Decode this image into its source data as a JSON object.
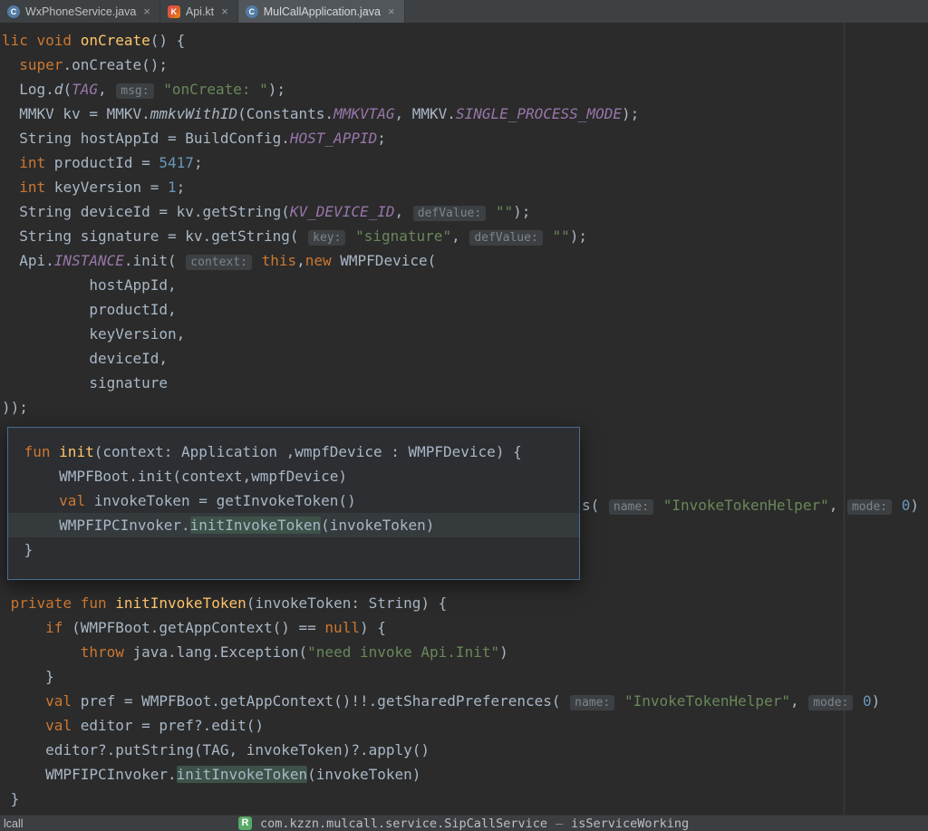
{
  "tab_bar": {
    "tabs": [
      {
        "id": "wxphoneservice-java",
        "label": "WxPhoneService.java",
        "icon": "java-class",
        "icon_letter": "C",
        "close": "×",
        "active": false
      },
      {
        "id": "api-kt",
        "label": "Api.kt",
        "icon": "kotlin",
        "icon_letter": "K",
        "close": "×",
        "active": false
      },
      {
        "id": "mulcallapplication-java",
        "label": "MulCallApplication.java",
        "icon": "java-class",
        "icon_letter": "C",
        "close": "×",
        "active": true
      }
    ]
  },
  "editor": {
    "top_lines": [
      {
        "tokens": [
          {
            "t": "lic ",
            "c": "kw"
          },
          {
            "t": "void ",
            "c": "kw"
          },
          {
            "t": "onCreate",
            "c": "method"
          },
          {
            "t": "() {",
            "c": "plain"
          }
        ]
      },
      {
        "tokens": [
          {
            "t": "  ",
            "c": "plain"
          },
          {
            "t": "super",
            "c": "kw"
          },
          {
            "t": ".onCreate();",
            "c": "plain"
          }
        ]
      },
      {
        "tokens": [
          {
            "t": "  Log.",
            "c": "plain"
          },
          {
            "t": "d",
            "c": "smethod"
          },
          {
            "t": "(",
            "c": "plain"
          },
          {
            "t": "TAG",
            "c": "const"
          },
          {
            "t": ", ",
            "c": "plain"
          },
          {
            "t": "msg:",
            "c": "hint"
          },
          {
            "t": " ",
            "c": "plain"
          },
          {
            "t": "\"onCreate: \"",
            "c": "str"
          },
          {
            "t": ");",
            "c": "plain"
          }
        ]
      },
      {
        "tokens": [
          {
            "t": "  MMKV kv = MMKV.",
            "c": "plain"
          },
          {
            "t": "mmkvWithID",
            "c": "smethod"
          },
          {
            "t": "(Constants.",
            "c": "plain"
          },
          {
            "t": "MMKVTAG",
            "c": "const"
          },
          {
            "t": ", MMKV.",
            "c": "plain"
          },
          {
            "t": "SINGLE_PROCESS_MODE",
            "c": "const"
          },
          {
            "t": ");",
            "c": "plain"
          }
        ]
      },
      {
        "tokens": [
          {
            "t": "  String hostAppId = BuildConfig.",
            "c": "plain"
          },
          {
            "t": "HOST_APPID",
            "c": "const"
          },
          {
            "t": ";",
            "c": "plain"
          }
        ]
      },
      {
        "tokens": [
          {
            "t": "  ",
            "c": "plain"
          },
          {
            "t": "int",
            "c": "kw"
          },
          {
            "t": " productId = ",
            "c": "plain"
          },
          {
            "t": "5417",
            "c": "num"
          },
          {
            "t": ";",
            "c": "plain"
          }
        ]
      },
      {
        "tokens": [
          {
            "t": "  ",
            "c": "plain"
          },
          {
            "t": "int",
            "c": "kw"
          },
          {
            "t": " keyVersion = ",
            "c": "plain"
          },
          {
            "t": "1",
            "c": "num"
          },
          {
            "t": ";",
            "c": "plain"
          }
        ]
      },
      {
        "tokens": [
          {
            "t": "  String deviceId = kv.getString(",
            "c": "plain"
          },
          {
            "t": "KV_DEVICE_ID",
            "c": "const"
          },
          {
            "t": ", ",
            "c": "plain"
          },
          {
            "t": "defValue:",
            "c": "hint"
          },
          {
            "t": " ",
            "c": "plain"
          },
          {
            "t": "\"\"",
            "c": "str"
          },
          {
            "t": ");",
            "c": "plain"
          }
        ]
      },
      {
        "tokens": [
          {
            "t": "  String signature = kv.getString( ",
            "c": "plain"
          },
          {
            "t": "key:",
            "c": "hint"
          },
          {
            "t": " ",
            "c": "plain"
          },
          {
            "t": "\"signature\"",
            "c": "str"
          },
          {
            "t": ", ",
            "c": "plain"
          },
          {
            "t": "defValue:",
            "c": "hint"
          },
          {
            "t": " ",
            "c": "plain"
          },
          {
            "t": "\"\"",
            "c": "str"
          },
          {
            "t": ");",
            "c": "plain"
          }
        ]
      },
      {
        "tokens": [
          {
            "t": "  Api.",
            "c": "plain"
          },
          {
            "t": "INSTANCE",
            "c": "const"
          },
          {
            "t": ".init( ",
            "c": "plain"
          },
          {
            "t": "context:",
            "c": "hint"
          },
          {
            "t": " ",
            "c": "plain"
          },
          {
            "t": "this",
            "c": "kw"
          },
          {
            "t": ",",
            "c": "plain"
          },
          {
            "t": "new",
            "c": "kw"
          },
          {
            "t": " WMPFDevice(",
            "c": "plain"
          }
        ]
      },
      {
        "tokens": [
          {
            "t": "          hostAppId,",
            "c": "plain"
          }
        ]
      },
      {
        "tokens": [
          {
            "t": "          productId,",
            "c": "plain"
          }
        ]
      },
      {
        "tokens": [
          {
            "t": "          keyVersion,",
            "c": "plain"
          }
        ]
      },
      {
        "tokens": [
          {
            "t": "          deviceId,",
            "c": "plain"
          }
        ]
      },
      {
        "tokens": [
          {
            "t": "          signature",
            "c": "plain"
          }
        ]
      },
      {
        "tokens": [
          {
            "t": "));",
            "c": "plain"
          }
        ]
      }
    ],
    "fragment_lines": [
      {
        "tokens": [
          {
            "t": "s( ",
            "c": "plain"
          },
          {
            "t": "name:",
            "c": "hint"
          },
          {
            "t": " ",
            "c": "plain"
          },
          {
            "t": "\"InvokeTokenHelper\"",
            "c": "str"
          },
          {
            "t": ", ",
            "c": "plain"
          },
          {
            "t": "mode:",
            "c": "hint"
          },
          {
            "t": " ",
            "c": "plain"
          },
          {
            "t": "0",
            "c": "num"
          },
          {
            "t": ")",
            "c": "plain"
          }
        ]
      }
    ],
    "lower_lines": [
      {
        "tokens": [
          {
            "t": " ",
            "c": "plain"
          },
          {
            "t": "private fun ",
            "c": "kw"
          },
          {
            "t": "initInvokeToken",
            "c": "method"
          },
          {
            "t": "(invokeToken: String) {",
            "c": "plain"
          }
        ]
      },
      {
        "tokens": [
          {
            "t": "     ",
            "c": "plain"
          },
          {
            "t": "if",
            "c": "kw"
          },
          {
            "t": " (WMPFBoot.getAppContext() == ",
            "c": "plain"
          },
          {
            "t": "null",
            "c": "kw"
          },
          {
            "t": ") {",
            "c": "plain"
          }
        ]
      },
      {
        "tokens": [
          {
            "t": "         ",
            "c": "plain"
          },
          {
            "t": "throw",
            "c": "kw"
          },
          {
            "t": " java.lang.Exception(",
            "c": "plain"
          },
          {
            "t": "\"need invoke Api.Init\"",
            "c": "str"
          },
          {
            "t": ")",
            "c": "plain"
          }
        ]
      },
      {
        "tokens": [
          {
            "t": "     }",
            "c": "plain"
          }
        ]
      },
      {
        "tokens": [
          {
            "t": "     ",
            "c": "plain"
          },
          {
            "t": "val",
            "c": "kw"
          },
          {
            "t": " pref = WMPFBoot.getAppContext()!!.getSharedPreferences( ",
            "c": "plain"
          },
          {
            "t": "name:",
            "c": "hint"
          },
          {
            "t": " ",
            "c": "plain"
          },
          {
            "t": "\"InvokeTokenHelper\"",
            "c": "str"
          },
          {
            "t": ", ",
            "c": "plain"
          },
          {
            "t": "mode:",
            "c": "hint"
          },
          {
            "t": " ",
            "c": "plain"
          },
          {
            "t": "0",
            "c": "num"
          },
          {
            "t": ")",
            "c": "plain"
          }
        ]
      },
      {
        "tokens": [
          {
            "t": "     ",
            "c": "plain"
          },
          {
            "t": "val",
            "c": "kw"
          },
          {
            "t": " editor = pref?.edit()",
            "c": "plain"
          }
        ]
      },
      {
        "tokens": [
          {
            "t": "     editor?.putString(TAG, invokeToken)?.apply()",
            "c": "plain"
          }
        ]
      },
      {
        "tokens": [
          {
            "t": "     WMPFIPCInvoker.",
            "c": "plain"
          },
          {
            "t": "initInvokeToken",
            "c": "hl"
          },
          {
            "t": "(invokeToken)",
            "c": "plain"
          }
        ]
      },
      {
        "tokens": [
          {
            "t": " }",
            "c": "plain"
          }
        ]
      }
    ]
  },
  "popup": {
    "lines": [
      {
        "tokens": [
          {
            "t": " ",
            "c": "plain"
          },
          {
            "t": "fun ",
            "c": "kw"
          },
          {
            "t": "init",
            "c": "method"
          },
          {
            "t": "(context: Application ,wmpfDevice : WMPFDevice) {",
            "c": "plain"
          }
        ]
      },
      {
        "tokens": [
          {
            "t": "     WMPFBoot.init(context,wmpfDevice)",
            "c": "plain"
          }
        ]
      },
      {
        "tokens": [
          {
            "t": "     ",
            "c": "plain"
          },
          {
            "t": "val",
            "c": "kw"
          },
          {
            "t": " invokeToken = getInvokeToken()",
            "c": "plain"
          }
        ]
      },
      {
        "highlight": true,
        "tokens": [
          {
            "t": "     WMPFIPCInvoker.",
            "c": "plain"
          },
          {
            "t": "initInvokeToken",
            "c": "hl"
          },
          {
            "t": "(invokeToken)",
            "c": "plain"
          }
        ]
      },
      {
        "tokens": [
          {
            "t": " }",
            "c": "plain"
          }
        ]
      }
    ]
  },
  "bottom_bar": {
    "tool_tab": "lcall",
    "run_icon_letter": "R",
    "process": "com.kzzn.mulcall.service.SipCallService",
    "separator": "—",
    "method": "isServiceWorking"
  },
  "colors": {
    "editor_bg": "#2b2b2b",
    "tab_bar_bg": "#3d4144",
    "active_tab_bg": "#51565b",
    "keyword": "#cc7832",
    "string": "#6a8759",
    "number": "#6897bb",
    "constant": "#9876aa",
    "method": "#ffc66b",
    "text": "#a9b7c6",
    "hint_bg": "#3c4043",
    "hint_fg": "#7e848b",
    "popup_border": "#4a6d8f",
    "identifier_highlight_bg": "#3d5248",
    "run_icon_green": "#59a869"
  }
}
